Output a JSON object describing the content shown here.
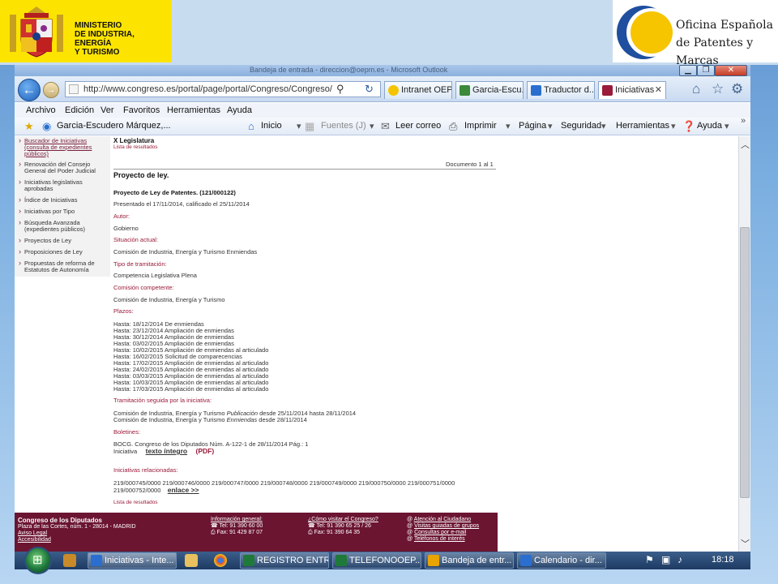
{
  "slide": {
    "ministry_lines": [
      "MINISTERIO",
      "DE INDUSTRIA, ENERGÍA",
      "Y TURISMO"
    ],
    "oepm_lines": [
      "Oficina Española",
      "de Patentes y Marcas"
    ]
  },
  "window": {
    "title": "Bandeja de entrada - direccion@oepm.es - Microsoft Outlook",
    "minimize": "▁",
    "maximize": "❐",
    "close": "✕"
  },
  "nav": {
    "back": "←",
    "forward": "→",
    "url": "http://www.congreso.es/portal/page/portal/Congreso/Congreso/",
    "search_icon": "⚲",
    "refresh_icon": "↻",
    "tabs": [
      {
        "label": "Intranet OEP...",
        "icon_color": "#f5c400"
      },
      {
        "label": "Garcia-Escu...",
        "icon_color": "#3a8a3a"
      },
      {
        "label": "Traductor d...",
        "icon_color": "#2a6fd0"
      },
      {
        "label": "Iniciativas",
        "icon_color": "#9a1b3a",
        "close": "✕"
      }
    ],
    "home_icon": "⌂",
    "favorites_icon": "☆",
    "tools_icon": "⚙"
  },
  "menu": [
    "Archivo",
    "Edición",
    "Ver",
    "Favoritos",
    "Herramientas",
    "Ayuda"
  ],
  "favbar": {
    "favorites_icon": "★",
    "link": "Garcia-Escudero Márquez,...",
    "items": [
      "Inicio",
      "Fuentes (J)",
      "Leer correo",
      "Imprimir",
      "Página",
      "Seguridad",
      "Herramientas",
      "Ayuda"
    ],
    "more": "»"
  },
  "leftnav": [
    [
      "Buscador de Iniciativas",
      "(consulta de expedientes",
      "públicos)"
    ],
    [
      "Renovación del Consejo",
      "General del Poder Judicial"
    ],
    [
      "Iniciativas legislativas",
      "aprobadas"
    ],
    [
      "Índice de Iniciativas"
    ],
    [
      "Iniciativas por Tipo"
    ],
    [
      "Búsqueda Avanzada",
      "(expedientes públicos)"
    ],
    [
      "Proyectos de Ley"
    ],
    [
      "Proposiciones de Ley"
    ],
    [
      "Propuestas de reforma de",
      "Estatutos de Autonomía"
    ]
  ],
  "doc": {
    "legislatura": "X Legislatura",
    "results_link": "Lista de resultados",
    "document_count": "Documento 1 al 1",
    "type": "Proyecto de ley.",
    "title": "Proyecto de Ley de Patentes. (121/000122)",
    "presented": "Presentado el 17/11/2014, calificado el 25/11/2014",
    "sections": [
      {
        "label": "Autor:",
        "lines": [
          "Gobierno"
        ]
      },
      {
        "label": "Situación actual:",
        "lines": [
          "Comisión de Industria, Energía y Turismo Enmiendas"
        ]
      },
      {
        "label": "Tipo de tramitación:",
        "lines": [
          "Competencia Legislativa Plena"
        ]
      },
      {
        "label": "Comisión competente:",
        "lines": [
          "Comisión de Industria, Energía y Turismo"
        ]
      }
    ],
    "plazos_label": "Plazos:",
    "plazos": [
      "Hasta: 18/12/2014 De enmiendas",
      "Hasta: 23/12/2014 Ampliación de enmiendas",
      "Hasta: 30/12/2014 Ampliación de enmiendas",
      "Hasta: 03/02/2015 Ampliación de enmiendas",
      "Hasta: 10/02/2015 Ampliación de enmiendas al articulado",
      "Hasta: 16/02/2015 Solicitud de comparecencias",
      "Hasta: 17/02/2015 Ampliación de enmiendas al articulado",
      "Hasta: 24/02/2015 Ampliación de enmiendas al articulado",
      "Hasta: 03/03/2015 Ampliación de enmiendas al articulado",
      "Hasta: 10/03/2015 Ampliación de enmiendas al articulado",
      "Hasta: 17/03/2015 Ampliación de enmiendas al articulado"
    ],
    "tramitacion_label": "Tramitación seguida por la iniciativa:",
    "tramitacion": [
      {
        "prefix": "Comisión de Industria, Energía y Turismo ",
        "em": "Publicación",
        "suffix": " desde 25/11/2014 hasta 28/11/2014"
      },
      {
        "prefix": "Comisión de Industria, Energía y Turismo ",
        "em": "Enmiendas",
        "suffix": " desde 28/11/2014"
      }
    ],
    "boletines_label": "Boletines:",
    "boletin": "BOCG. Congreso de los Diputados Núm. A-122-1 de 28/11/2014 Pág.: 1",
    "iniciativa_word": "Iniciativa",
    "texto_integro": "texto íntegro",
    "pdf": "(PDF)",
    "relacionadas_label": "Iniciativas relacionadas:",
    "relacionadas_line1": "219/000745/0000 219/000746/0000 219/000747/0000 219/000748/0000 219/000749/0000 219/000750/0000 219/000751/0000",
    "relacionadas_line2": "219/000752/0000",
    "enlace": "enlace >>",
    "results_link_bottom": "Lista de resultados"
  },
  "footer": {
    "col1": [
      "Congreso de los Diputados",
      "Plaza de las Cortes, núm. 1 - 28014 - MADRID",
      "Aviso Legal",
      "Accesibilidad"
    ],
    "col2": [
      "Información general:",
      "Tel: 91 390 60 00",
      "Fax: 91 429 87 07"
    ],
    "col3": [
      "¿Cómo visitar el Congreso?",
      "Tel: 91 390 65 25 / 26",
      "Fax: 91 390 64 35"
    ],
    "col4": [
      "Atención al Ciudadano",
      "Visitas guiadas de grupos",
      "Consultas por e-mail",
      "Teléfonos de interés"
    ]
  },
  "taskbar": {
    "buttons": [
      {
        "label": "Iniciativas - Inte...",
        "color": "#2a6fd0"
      },
      {
        "label": "REGISTRO ENTR...",
        "color": "#1f7a3a"
      },
      {
        "label": "TELEFONOOEP...",
        "color": "#1f7a3a"
      },
      {
        "label": "Bandeja de entr...",
        "color": "#e8a400"
      },
      {
        "label": "Calendario - dir...",
        "color": "#2a6fd0"
      }
    ],
    "tray_icons": [
      "⚑",
      "▣",
      "♪"
    ],
    "clock": "18:18"
  }
}
